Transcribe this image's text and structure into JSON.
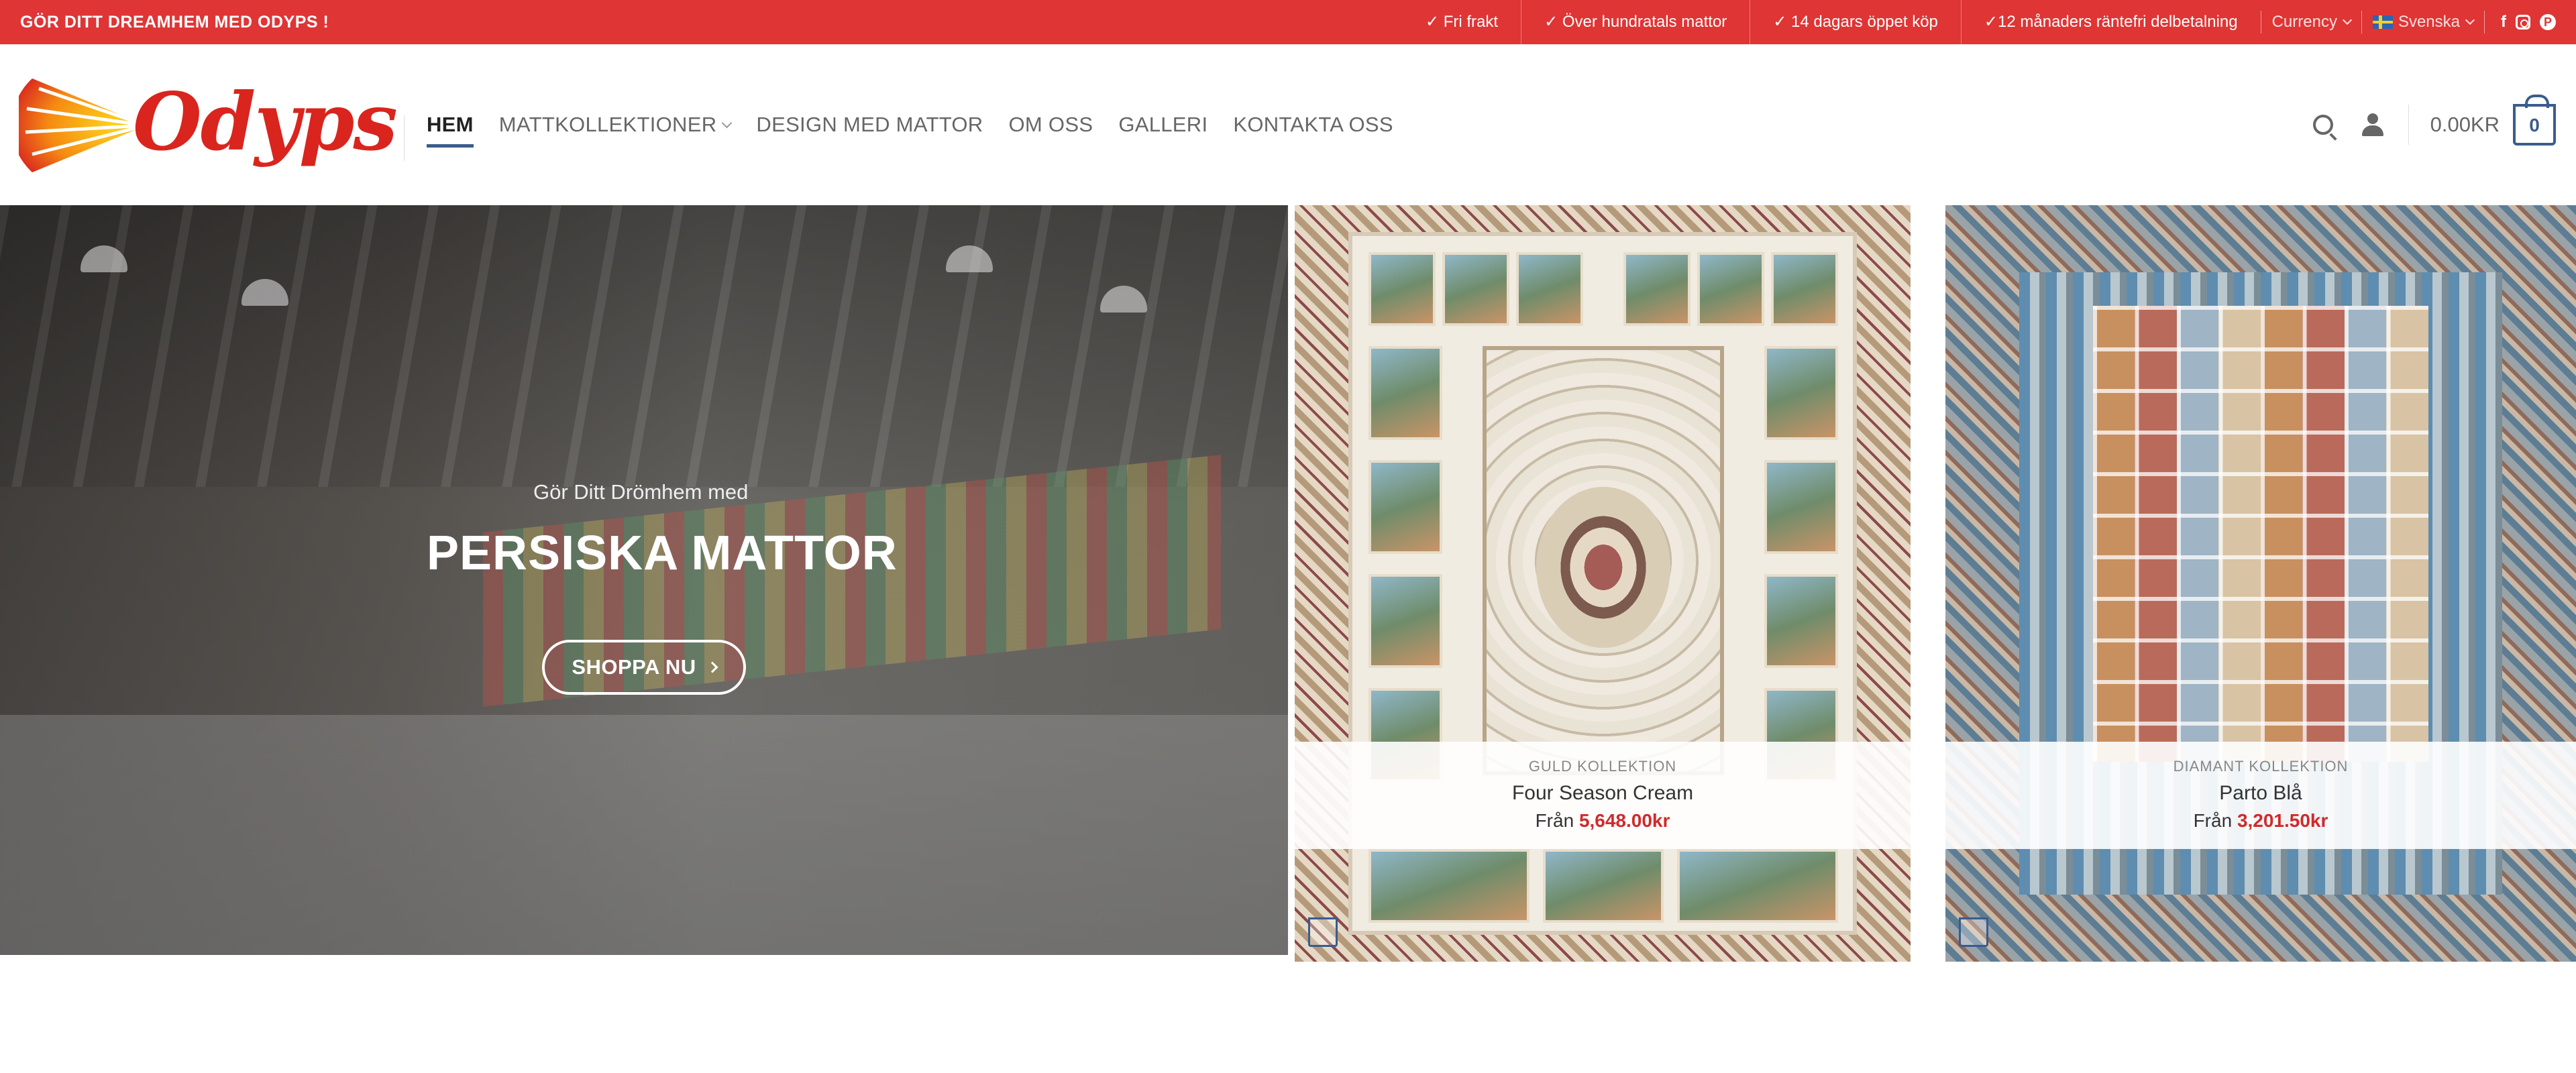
{
  "topbar": {
    "promo": "GÖR DITT DREAMHEM MED ODYPS !",
    "perks": [
      "✓ Fri frakt",
      "✓ Över hundratals mattor",
      "✓ 14 dagars öppet köp",
      "✓12 månaders räntefri delbetalning"
    ],
    "currency_label": "Currency",
    "language_label": "Svenska",
    "social": {
      "facebook": "f",
      "pinterest": "P"
    }
  },
  "header": {
    "logo_text": "Odyps",
    "nav": [
      {
        "label": "HEM",
        "active": true
      },
      {
        "label": "MATTKOLLEKTIONER",
        "dropdown": true
      },
      {
        "label": "DESIGN MED MATTOR"
      },
      {
        "label": "OM OSS"
      },
      {
        "label": "GALLERI"
      },
      {
        "label": "KONTAKTA OSS"
      }
    ],
    "cart_total": "0.00KR",
    "cart_count": "0"
  },
  "hero": {
    "subtitle": "Gör Ditt Drömhem med",
    "title": "PERSISKA MATTOR",
    "button_label": "SHOPPA NU"
  },
  "products": [
    {
      "category": "GULD KOLLEKTION",
      "name": "Four Season Cream",
      "price_prefix": "Från",
      "price": "5,648.00kr"
    },
    {
      "category": "DIAMANT KOLLEKTION",
      "name": "Parto Blå",
      "price_prefix": "Från",
      "price": "3,201.50kr"
    }
  ],
  "colors": {
    "topbar": "#df3535",
    "accent": "#3a5c8c",
    "price": "#d12a2a"
  }
}
